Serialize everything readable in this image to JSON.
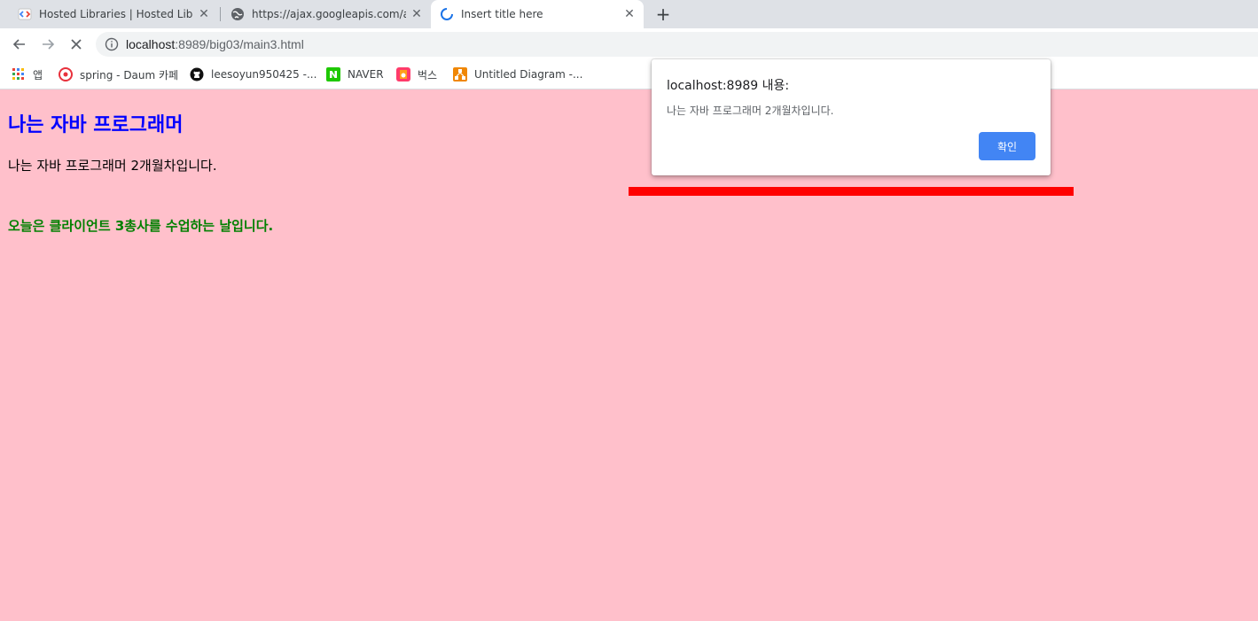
{
  "tabs": [
    {
      "title": "Hosted Libraries  |  Hosted Libraries",
      "icon": "code-brackets-icon",
      "active": false
    },
    {
      "title": "https://ajax.googleapis.com/ajax/libs",
      "icon": "globe-icon",
      "active": false
    },
    {
      "title": "Insert title here",
      "icon": "loading-spinner-icon",
      "active": true
    }
  ],
  "toolbar": {
    "url_host": "localhost",
    "url_rest": ":8989/big03/main3.html"
  },
  "bookmarks": [
    {
      "label": "앱",
      "icon": "apps-grid-icon"
    },
    {
      "label": "spring - Daum 카페",
      "icon": "daum-cafe-icon"
    },
    {
      "label": "leesoyun950425 -...",
      "icon": "github-icon"
    },
    {
      "label": "NAVER",
      "icon": "naver-icon"
    },
    {
      "label": "벅스",
      "icon": "bugs-icon"
    },
    {
      "label": "Untitled Diagram -...",
      "icon": "drawio-icon"
    }
  ],
  "page": {
    "heading": "나는 자바 프로그래머",
    "paragraph": "나는 자바 프로그래머 2개월차입니다.",
    "green_text": "오늘은 클라이언트 3총사를 수업하는 날입니다."
  },
  "dialog": {
    "title": "localhost:8989 내용:",
    "message": "나는 자바 프로그래머 2개월차입니다.",
    "ok_label": "확인"
  },
  "colors": {
    "page_background": "#ffc0cb",
    "heading": "#0000ff",
    "green_text": "#008000",
    "red_bar": "#ff0000",
    "ok_button": "#4285f4"
  }
}
